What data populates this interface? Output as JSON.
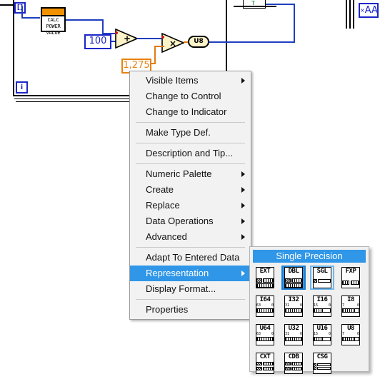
{
  "app": {
    "name": "LabVIEW Block Diagram",
    "accent_blue": "#2f96e8",
    "wire_blue": "#1e3fbe",
    "wire_orange": "#e07b12",
    "subvi_orange": "#f29200"
  },
  "diagram": {
    "subvi": {
      "name": "calc-power-value-subvi",
      "line1": "CALC",
      "line2": "POWER",
      "line3": "VALUE"
    },
    "constant_int": {
      "name": "numeric-constant-100",
      "value": "100"
    },
    "constant_dbl": {
      "name": "numeric-constant-1275",
      "value": "1,275"
    },
    "add_node": {
      "name": "add-function",
      "symbol": "+"
    },
    "multiply_node": {
      "name": "multiply-function",
      "symbol": "×"
    },
    "conversion_node": {
      "name": "to-u8-conversion",
      "label": "U8"
    },
    "iteration_terminal": {
      "name": "loop-iteration-terminal",
      "label": "i"
    },
    "array_terminal": {
      "name": "array-terminal",
      "label": "[]"
    },
    "string_constant": {
      "name": "string-constant-aa",
      "value": "AA"
    }
  },
  "context_menu": {
    "items": [
      {
        "label": "Visible Items",
        "submenu": true,
        "selected": false,
        "sep_after": false
      },
      {
        "label": "Change to Control",
        "submenu": false,
        "selected": false,
        "sep_after": false
      },
      {
        "label": "Change to Indicator",
        "submenu": false,
        "selected": false,
        "sep_after": true
      },
      {
        "label": "Make Type Def.",
        "submenu": false,
        "selected": false,
        "sep_after": true
      },
      {
        "label": "Description and Tip...",
        "submenu": false,
        "selected": false,
        "sep_after": true
      },
      {
        "label": "Numeric Palette",
        "submenu": true,
        "selected": false,
        "sep_after": false
      },
      {
        "label": "Create",
        "submenu": true,
        "selected": false,
        "sep_after": false
      },
      {
        "label": "Replace",
        "submenu": true,
        "selected": false,
        "sep_after": false
      },
      {
        "label": "Data Operations",
        "submenu": true,
        "selected": false,
        "sep_after": false
      },
      {
        "label": "Advanced",
        "submenu": true,
        "selected": false,
        "sep_after": true
      },
      {
        "label": "Adapt To Entered Data",
        "submenu": false,
        "selected": false,
        "sep_after": false
      },
      {
        "label": "Representation",
        "submenu": true,
        "selected": true,
        "sep_after": false
      },
      {
        "label": "Display Format...",
        "submenu": false,
        "selected": false,
        "sep_after": true
      },
      {
        "label": "Properties",
        "submenu": false,
        "selected": false,
        "sep_after": false
      }
    ]
  },
  "representation_palette": {
    "title": "Single Precision",
    "rows": [
      [
        {
          "label": "EXT",
          "state": "normal",
          "glyph": "float",
          "tick_left": "",
          "tick_right": ""
        },
        {
          "label": "DBL",
          "state": "selected",
          "glyph": "float",
          "tick_left": "",
          "tick_right": ""
        },
        {
          "label": "SGL",
          "state": "hover",
          "glyph": "float_small",
          "tick_left": "",
          "tick_right": ""
        },
        {
          "label": "FXP",
          "state": "normal",
          "glyph": "fixed",
          "tick_left": "",
          "tick_right": ""
        }
      ],
      [
        {
          "label": "I64",
          "state": "normal",
          "glyph": "int",
          "tick_left": "63",
          "tick_right": "0"
        },
        {
          "label": "I32",
          "state": "normal",
          "glyph": "int",
          "tick_left": "31",
          "tick_right": "0"
        },
        {
          "label": "I16",
          "state": "normal",
          "glyph": "int_half",
          "tick_left": "15",
          "tick_right": "0"
        },
        {
          "label": "I8",
          "state": "normal",
          "glyph": "int_quarter",
          "tick_left": "7",
          "tick_right": "0"
        }
      ],
      [
        {
          "label": "U64",
          "state": "normal",
          "glyph": "int",
          "tick_left": "63",
          "tick_right": "0"
        },
        {
          "label": "U32",
          "state": "normal",
          "glyph": "int",
          "tick_left": "31",
          "tick_right": "0"
        },
        {
          "label": "U16",
          "state": "normal",
          "glyph": "int_half",
          "tick_left": "15",
          "tick_right": "0"
        },
        {
          "label": "U8",
          "state": "normal",
          "glyph": "int_quarter",
          "tick_left": "7",
          "tick_right": "0"
        }
      ],
      [
        {
          "label": "CXT",
          "state": "normal",
          "glyph": "complex",
          "tick_left": "",
          "tick_right": ""
        },
        {
          "label": "CDB",
          "state": "normal",
          "glyph": "complex",
          "tick_left": "",
          "tick_right": ""
        },
        {
          "label": "CSG",
          "state": "normal",
          "glyph": "complex_small",
          "tick_left": "",
          "tick_right": ""
        }
      ]
    ]
  }
}
